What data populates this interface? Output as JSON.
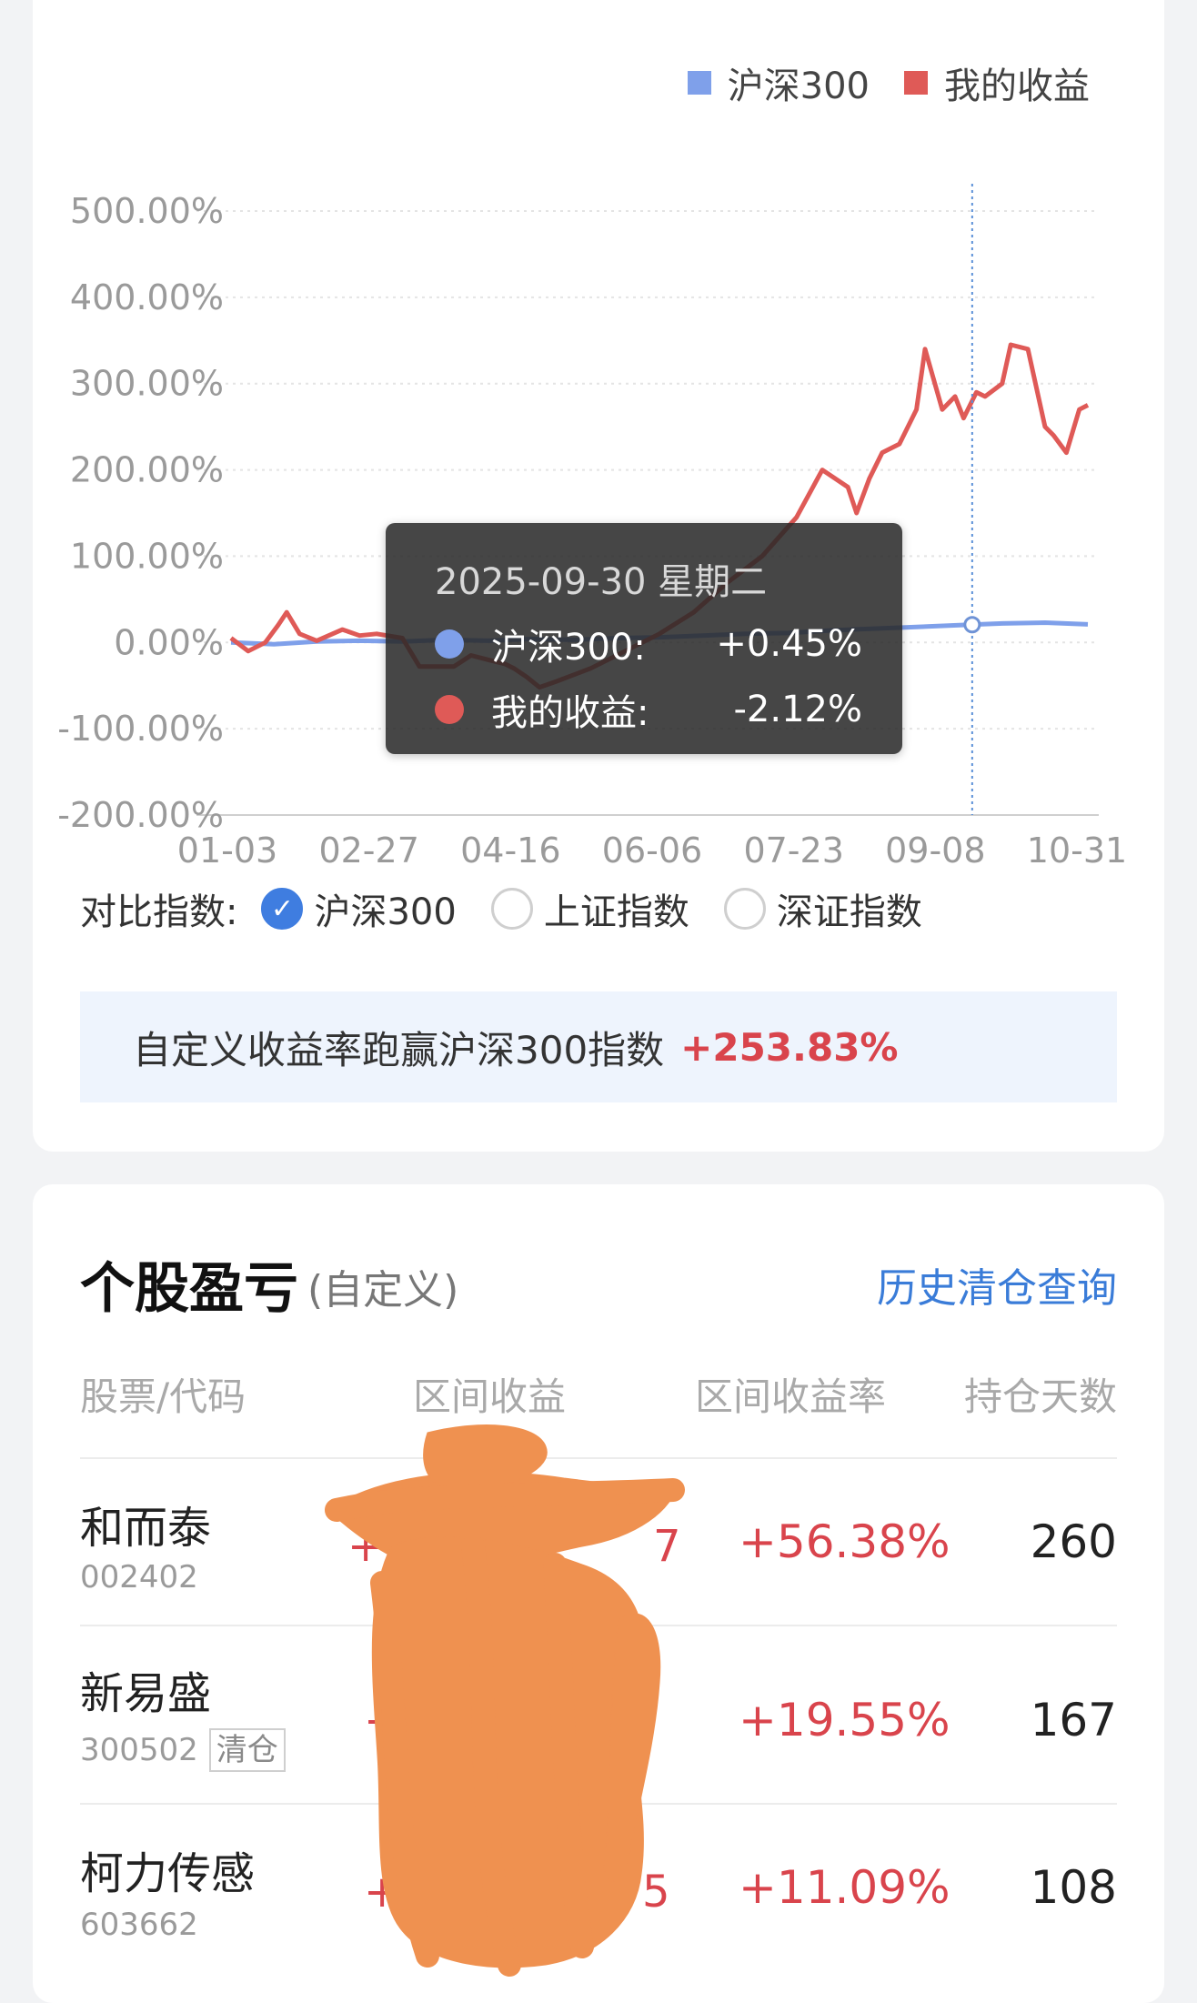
{
  "legend": [
    {
      "label": "沪深300",
      "color": "#7fa0ea"
    },
    {
      "label": "我的收益",
      "color": "#df5a57"
    }
  ],
  "chart_data": {
    "type": "line",
    "y_ticks": [
      "500.00%",
      "400.00%",
      "300.00%",
      "200.00%",
      "100.00%",
      "0.00%",
      "-100.00%",
      "-200.00%"
    ],
    "x_ticks": [
      "01-03",
      "02-27",
      "04-16",
      "06-06",
      "07-23",
      "09-08",
      "10-31"
    ],
    "ylim": [
      -200,
      500
    ],
    "grid": true,
    "series": [
      {
        "name": "沪深300",
        "color": "#7fa0ea",
        "x": [
          0,
          0.05,
          0.1,
          0.15,
          0.2,
          0.25,
          0.3,
          0.35,
          0.4,
          0.45,
          0.5,
          0.55,
          0.6,
          0.65,
          0.7,
          0.75,
          0.8,
          0.85,
          0.9,
          0.95,
          1.0
        ],
        "values": [
          0,
          -2,
          1,
          2,
          1,
          3,
          2,
          4,
          3,
          5,
          6,
          8,
          10,
          11,
          14,
          16,
          18,
          20,
          22,
          23,
          21
        ]
      },
      {
        "name": "我的收益",
        "color": "#df5a57",
        "x": [
          0,
          0.02,
          0.04,
          0.055,
          0.065,
          0.08,
          0.1,
          0.13,
          0.15,
          0.17,
          0.2,
          0.22,
          0.26,
          0.28,
          0.3,
          0.32,
          0.33,
          0.345,
          0.36,
          0.38,
          0.42,
          0.46,
          0.5,
          0.54,
          0.58,
          0.62,
          0.66,
          0.69,
          0.72,
          0.73,
          0.745,
          0.76,
          0.78,
          0.8,
          0.81,
          0.83,
          0.845,
          0.855,
          0.87,
          0.88,
          0.9,
          0.91,
          0.93,
          0.95,
          0.96,
          0.975,
          0.99,
          1.0
        ],
        "values": [
          5,
          -10,
          0,
          20,
          35,
          10,
          2,
          15,
          8,
          10,
          5,
          -28,
          -28,
          -15,
          -20,
          -25,
          -30,
          -40,
          -52,
          -45,
          -30,
          -10,
          10,
          35,
          70,
          100,
          145,
          200,
          180,
          150,
          190,
          220,
          230,
          270,
          340,
          270,
          285,
          260,
          290,
          285,
          300,
          345,
          340,
          250,
          240,
          220,
          270,
          275
        ]
      }
    ],
    "crosshair_x": 0.865
  },
  "tooltip": {
    "date": "2025-09-30 星期二",
    "rows": [
      {
        "label": "沪深300:",
        "value": "+0.45%",
        "color": "#7fa0ea"
      },
      {
        "label": "我的收益:",
        "value": "-2.12%",
        "color": "#df5a57"
      }
    ]
  },
  "compare": {
    "label": "对比指数:",
    "options": [
      {
        "label": "沪深300",
        "checked": true
      },
      {
        "label": "上证指数",
        "checked": false
      },
      {
        "label": "深证指数",
        "checked": false
      }
    ]
  },
  "banner": {
    "text": "自定义收益率跑赢沪深300指数",
    "value": "+253.83%"
  },
  "stocks_section": {
    "title": "个股盈亏",
    "subtitle": "(自定义)",
    "history_link": "历史清仓查询",
    "columns": [
      "股票/代码",
      "区间收益",
      "区间收益率",
      "持仓天数"
    ],
    "rows": [
      {
        "name": "和而泰",
        "code": "002402",
        "tag": "",
        "pnl": "+1",
        "pnl_tail": "7",
        "rate": "+56.38%",
        "days": "260"
      },
      {
        "name": "新易盛",
        "code": "300502",
        "tag": "清仓",
        "pnl": "+",
        "pnl_tail": "",
        "rate": "+19.55%",
        "days": "167"
      },
      {
        "name": "柯力传感",
        "code": "603662",
        "tag": "",
        "pnl": "+",
        "pnl_tail": "5",
        "rate": "+11.09%",
        "days": "108"
      }
    ]
  }
}
